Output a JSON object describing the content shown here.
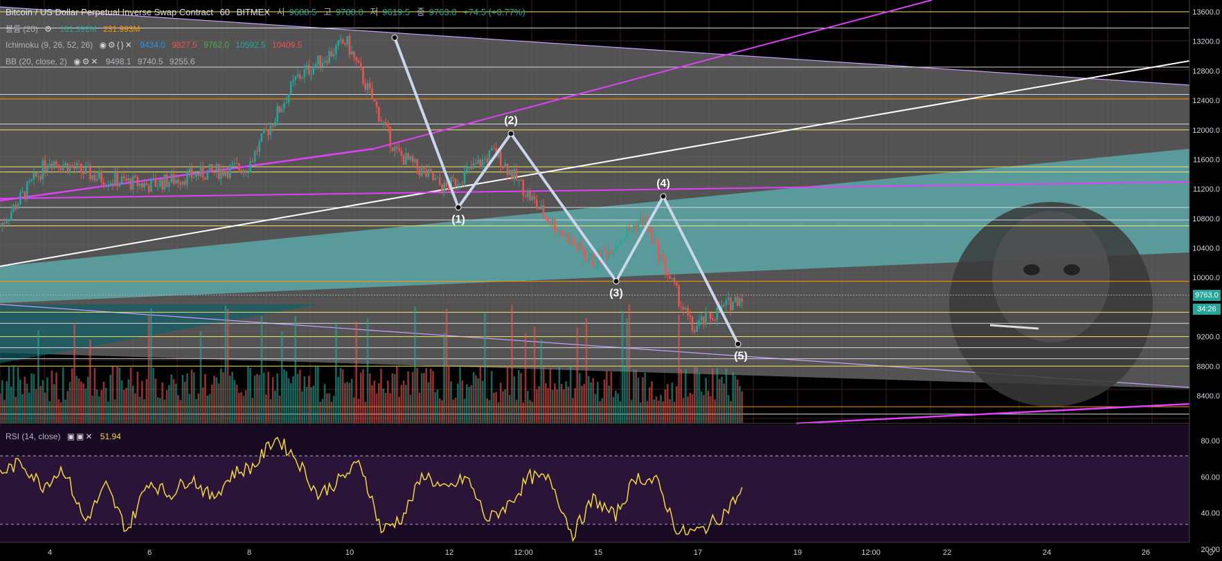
{
  "header": {
    "title": "Bitcoin / US Dollar Perpetual Inverse Swap Contract",
    "interval": "60",
    "exchange": "BITMEX",
    "open_label": "시",
    "open": "9688.5",
    "high_label": "고",
    "high": "9788.0",
    "low_label": "저",
    "low": "9619.5",
    "close_label": "종",
    "close": "9763.0",
    "change": "+74.5 (+0.77%)"
  },
  "indicators": {
    "volume": {
      "label": "볼륨 (20)",
      "v1": "161.392M",
      "v2": "231.993M"
    },
    "ichimoku": {
      "label": "Ichimoku (9, 26, 52, 26)",
      "v1": "9434.0",
      "v2": "9827.5",
      "v3": "9762.0",
      "v4": "10592.5",
      "v5": "10409.5"
    },
    "bb": {
      "label": "BB (20, close, 2)",
      "v1": "9498.1",
      "v2": "9740.5",
      "v3": "9255.6"
    },
    "rsi": {
      "label": "RSI (14, close)",
      "value": "51.94"
    }
  },
  "price_tag": "9763.0",
  "time_tag": "34:26",
  "colors": {
    "up": "#26a69a",
    "down": "#ef5350",
    "rsi": "#f5d742",
    "magenta": "#e040fb",
    "teal": "#5fc9c9",
    "hline_yellow": "#f5e663",
    "hline_orange": "#ff9800"
  },
  "chart_data": [
    {
      "type": "line",
      "title": "Bitcoin / US Dollar Perpetual Inverse Swap Contract · 60 · BITMEX",
      "x_ticks": [
        "4",
        "6",
        "8",
        "10",
        "12",
        "12:00",
        "15",
        "17",
        "19",
        "12:00",
        "22",
        "24",
        "26"
      ],
      "y_ticks": [
        "13600.0",
        "13200.0",
        "12800.0",
        "12400.0",
        "12000.0",
        "11600.0",
        "11200.0",
        "10800.0",
        "10400.0",
        "10000.0",
        "9600.0",
        "9200.0",
        "8800.0",
        "8400.0"
      ],
      "ylim": [
        8200,
        13600
      ],
      "series": [
        {
          "name": "close",
          "x": [
            "3",
            "4",
            "5",
            "6",
            "7",
            "8",
            "9",
            "10",
            "11",
            "12",
            "13",
            "14",
            "15",
            "16",
            "17",
            "18"
          ],
          "values": [
            10700,
            11600,
            11350,
            11250,
            11400,
            11500,
            12700,
            13200,
            11700,
            11200,
            11700,
            10850,
            10200,
            10800,
            9300,
            9763
          ]
        }
      ],
      "wave_points": [
        {
          "label": "(1)",
          "price": 10950
        },
        {
          "label": "(2)",
          "price": 11950
        },
        {
          "label": "(3)",
          "price": 9950
        },
        {
          "label": "(4)",
          "price": 11100
        },
        {
          "label": "(5)",
          "price": 9100
        }
      ]
    },
    {
      "type": "line",
      "title": "RSI (14, close)",
      "y_ticks": [
        "80.00",
        "60.00",
        "40.00",
        "20.00"
      ],
      "ylim": [
        20,
        85
      ],
      "bands": [
        30,
        70
      ],
      "series": [
        {
          "name": "RSI (14, close)",
          "values": [
            62,
            68,
            55,
            65,
            35,
            55,
            30,
            58,
            50,
            60,
            48,
            62,
            66,
            82,
            70,
            50,
            58,
            68,
            30,
            38,
            62,
            52,
            60,
            36,
            45,
            60,
            58,
            28,
            48,
            38,
            60,
            57,
            29,
            30,
            38,
            51.94
          ]
        }
      ]
    }
  ]
}
